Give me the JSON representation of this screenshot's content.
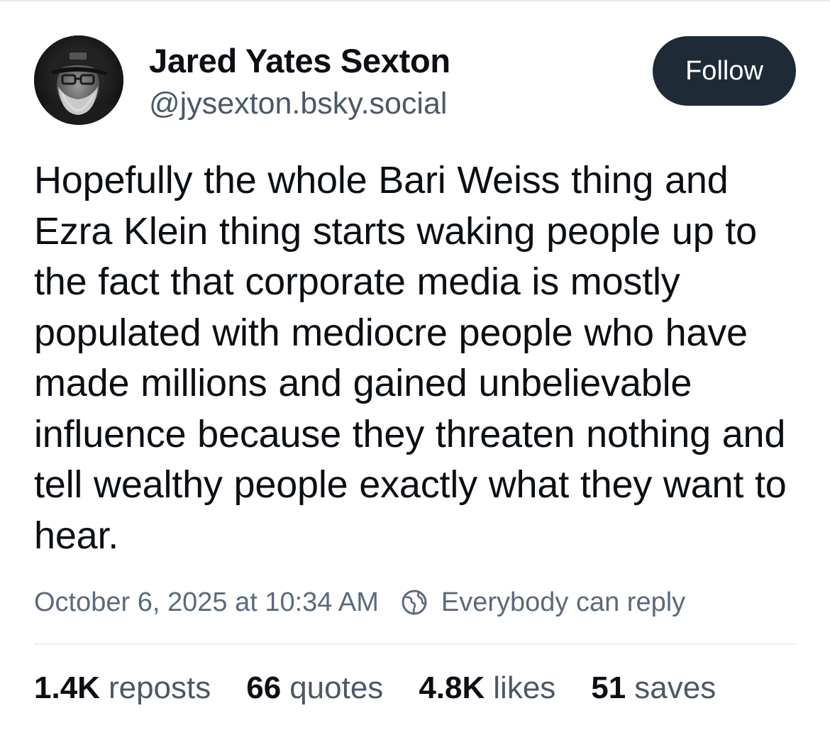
{
  "author": {
    "name": "Jared Yates Sexton",
    "handle": "@jysexton.bsky.social"
  },
  "follow_button": {
    "label": "Follow"
  },
  "post": {
    "text": "Hopefully the whole Bari Weiss thing and Ezra Klein thing starts waking people up to the fact that corporate media is mostly populated with mediocre people who have made millions and gained unbelievable influence because they threaten nothing and tell wealthy people exactly what they want to hear.",
    "timestamp": "October 6, 2025 at 10:34 AM",
    "reply_setting": "Everybody can reply"
  },
  "stats": [
    {
      "count": "1.4K",
      "label": "reposts"
    },
    {
      "count": "66",
      "label": "quotes"
    },
    {
      "count": "4.8K",
      "label": "likes"
    },
    {
      "count": "51",
      "label": "saves"
    }
  ],
  "colors": {
    "follow_button_bg": "#1f2a37",
    "muted_text": "#5b6a7a",
    "primary_text": "#0b0f14"
  },
  "icons": {
    "avatar": "profile-photo",
    "reply_setting": "globe-icon"
  }
}
